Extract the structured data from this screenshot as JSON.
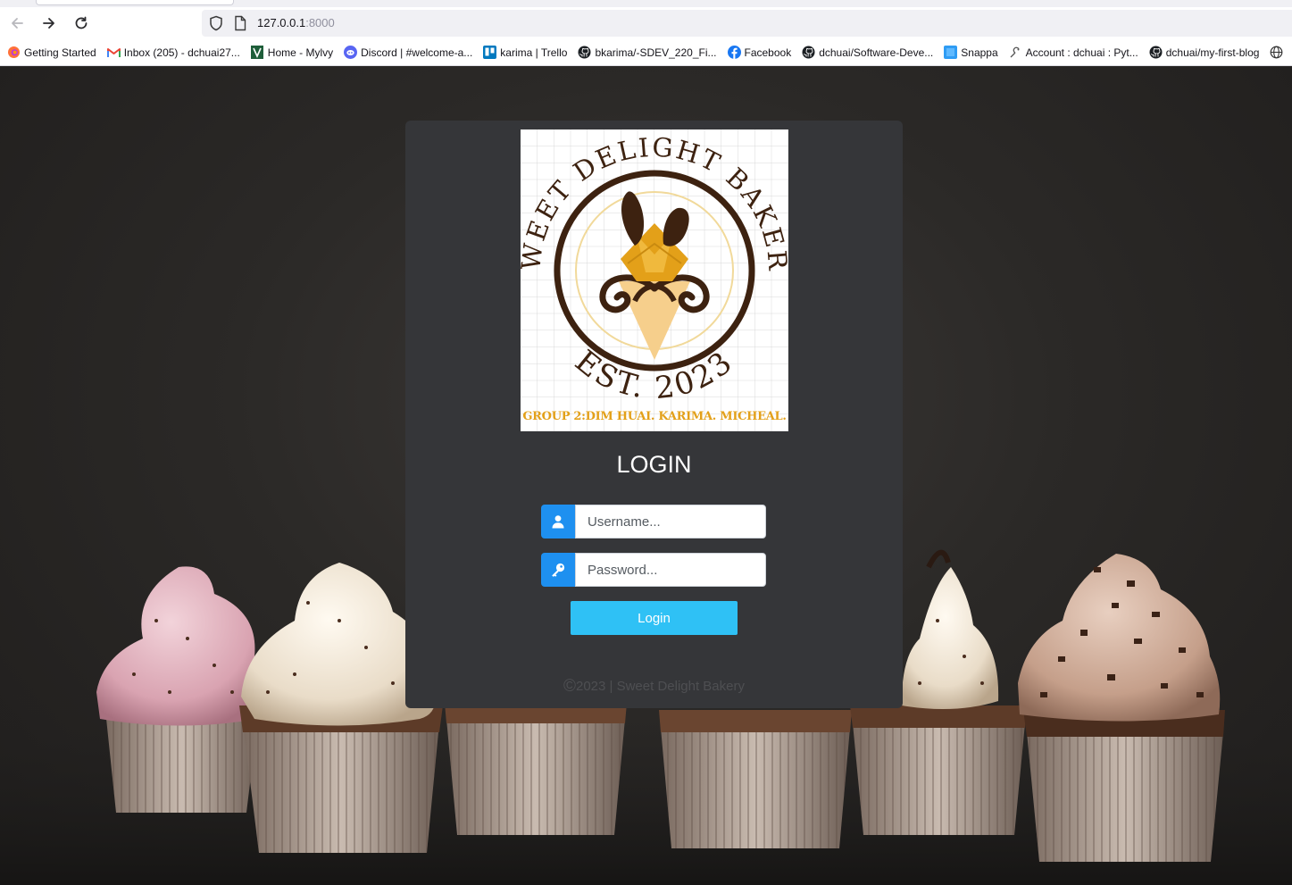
{
  "browser": {
    "url_host": "127.0.0.1",
    "url_port": ":8000",
    "bookmarks": [
      {
        "icon": "firefox-icon",
        "label": "Getting Started"
      },
      {
        "icon": "gmail-icon",
        "label": "Inbox (205) - dchuai27..."
      },
      {
        "icon": "mylvy-icon",
        "label": "Home - Mylvy"
      },
      {
        "icon": "discord-icon",
        "label": "Discord | #welcome-a..."
      },
      {
        "icon": "trello-icon",
        "label": "karima | Trello"
      },
      {
        "icon": "github-icon",
        "label": "bkarima/-SDEV_220_Fi..."
      },
      {
        "icon": "facebook-icon",
        "label": "Facebook"
      },
      {
        "icon": "github-icon",
        "label": "dchuai/Software-Deve..."
      },
      {
        "icon": "snappa-icon",
        "label": "Snappa"
      },
      {
        "icon": "pythonanywhere-icon",
        "label": "Account : dchuai : Pyt..."
      },
      {
        "icon": "github-icon",
        "label": "dchuai/my-first-blog"
      }
    ]
  },
  "logo": {
    "top_text": "SWEET DELIGHT BAKERY",
    "bottom_text": "EST. 2023",
    "group_text": "GROUP 2:DIM HUAI. KARIMA. MICHEAL."
  },
  "login": {
    "title": "LOGIN",
    "username_placeholder": "Username...",
    "password_placeholder": "Password...",
    "button_label": "Login",
    "footer_symbol": "©",
    "footer_text": "2023 | Sweet Delight Bakery"
  },
  "colors": {
    "card": "#353639",
    "input_addon": "#1e90f0",
    "login_button": "#2fc1f5",
    "logo_accent": "#e3a019",
    "logo_brown": "#3d2210"
  }
}
